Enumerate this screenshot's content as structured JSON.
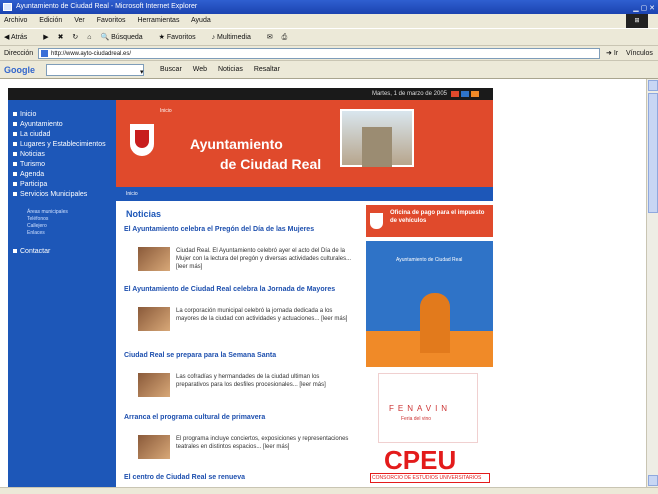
{
  "window": {
    "title": "Ayuntamiento de Ciudad Real - Microsoft Internet Explorer"
  },
  "menu": [
    "Archivo",
    "Edición",
    "Ver",
    "Favoritos",
    "Herramientas",
    "Ayuda"
  ],
  "toolbar": [
    "Atrás",
    "Búsqueda",
    "Favoritos",
    "Multimedia"
  ],
  "address": {
    "label": "Dirección",
    "url": "http://www.ayto-ciudadreal.es/",
    "go_label": "Ir",
    "links_label": "Vínculos"
  },
  "google": {
    "logo": "Google",
    "search_label": "Buscar",
    "items": [
      "Web",
      "Noticias",
      "Resaltar"
    ]
  },
  "site": {
    "top_strip": "Martes, 1 de marzo de 2005",
    "nav": [
      "Inicio",
      "Ayuntamiento",
      "La ciudad",
      "Lugares y Establecimientos",
      "Noticias",
      "Turismo",
      "Agenda",
      "Participa",
      "Servicios Municipales"
    ],
    "nav_sub": [
      "Áreas municipales",
      "Teléfonos",
      "Callejero",
      "Enlaces"
    ],
    "nav_extra": "Contactar",
    "header": {
      "brand": "Inicio",
      "title_line1": "Ayuntamiento",
      "title_line2": "de Ciudad Real"
    },
    "subbar": "Inicio",
    "news": {
      "heading": "Noticias",
      "items": [
        {
          "title": "El Ayuntamiento celebra el Pregón del Día de las Mujeres",
          "text": "Ciudad Real. El Ayuntamiento celebró ayer el acto del Día de la Mujer con la lectura del pregón y diversas actividades culturales... [leer más]"
        },
        {
          "title": "El Ayuntamiento de Ciudad Real celebra la Jornada de Mayores",
          "text": "La corporación municipal celebró la jornada dedicada a los mayores de la ciudad con actividades y actuaciones... [leer más]"
        },
        {
          "title": "Ciudad Real se prepara para la Semana Santa",
          "text": "Las cofradías y hermandades de la ciudad ultiman los preparativos para los desfiles procesionales... [leer más]"
        },
        {
          "title": "Arranca el programa cultural de primavera",
          "text": "El programa incluye conciertos, exposiciones y representaciones teatrales en distintos espacios... [leer más]"
        },
        {
          "title": "El centro de Ciudad Real se renueva",
          "text": ""
        }
      ]
    },
    "promos": {
      "p1": "Oficina de pago para el impuesto de vehículos",
      "p2_label": "Ayuntamiento de Ciudad Real",
      "p3_word": "FENAVIN",
      "p3_sub": "Feria del vino",
      "p4_big": "CPEU",
      "p4_small": "CONSORCIO DE ESTUDIOS UNIVERSITARIOS"
    }
  }
}
